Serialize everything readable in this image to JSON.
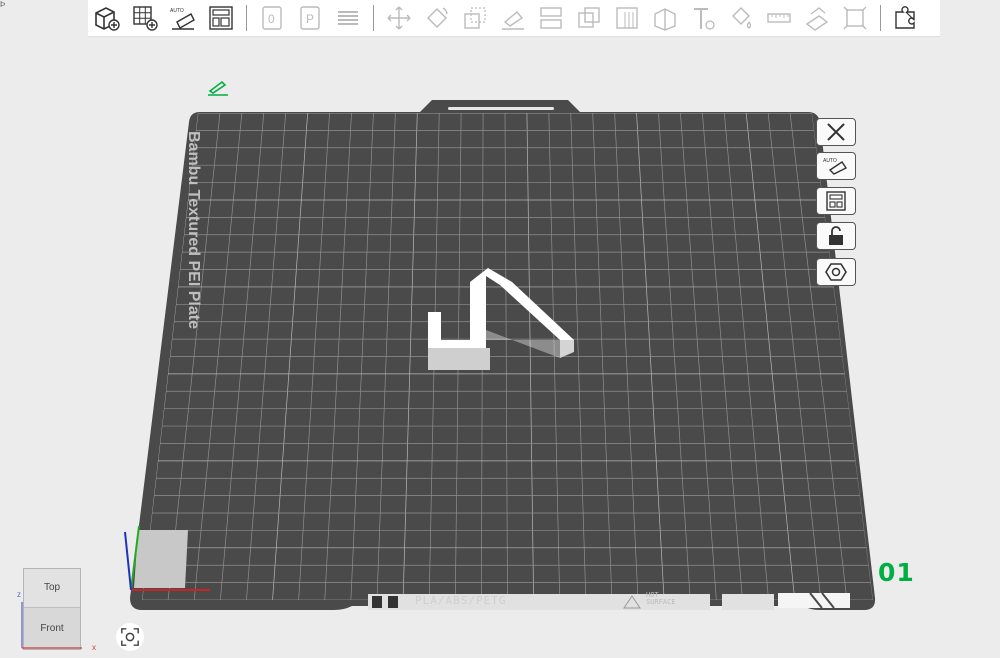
{
  "toolbar": {
    "buttons": [
      {
        "name": "add-object-icon"
      },
      {
        "name": "add-plate-icon"
      },
      {
        "name": "auto-orient-icon"
      },
      {
        "name": "arrange-icon"
      },
      {
        "name": "split-objects-icon"
      },
      {
        "name": "split-parts-icon"
      },
      {
        "name": "layers-icon"
      },
      {
        "name": "move-icon"
      },
      {
        "name": "rotate-icon"
      },
      {
        "name": "scale-icon"
      },
      {
        "name": "lay-on-face-icon"
      },
      {
        "name": "cut-icon"
      },
      {
        "name": "boolean-icon"
      },
      {
        "name": "support-paint-icon"
      },
      {
        "name": "seam-paint-icon"
      },
      {
        "name": "text-icon"
      },
      {
        "name": "color-paint-icon"
      },
      {
        "name": "measure-icon"
      },
      {
        "name": "assembly-icon"
      },
      {
        "name": "variable-layer-icon"
      },
      {
        "name": "puzzle-icon"
      }
    ]
  },
  "corner_mark": "Þ",
  "plate": {
    "label": "Bambu Textured PEI Plate",
    "number": "01",
    "filament": "PLA/ABS/PETG",
    "hot_line1": "HOT",
    "hot_line2": "SURFACE"
  },
  "side_buttons": [
    {
      "name": "remove-plate-icon"
    },
    {
      "name": "auto-orient-plate-icon"
    },
    {
      "name": "arrange-plate-icon"
    },
    {
      "name": "lock-plate-icon"
    },
    {
      "name": "plate-settings-icon"
    }
  ],
  "view_cube": {
    "top": "Top",
    "front": "Front",
    "axis_z": "z",
    "axis_x": "x"
  },
  "colors": {
    "accent": "#00ae42",
    "plate": "#4a4a4a",
    "grid": "#9a9a9a",
    "background": "#ececec"
  }
}
